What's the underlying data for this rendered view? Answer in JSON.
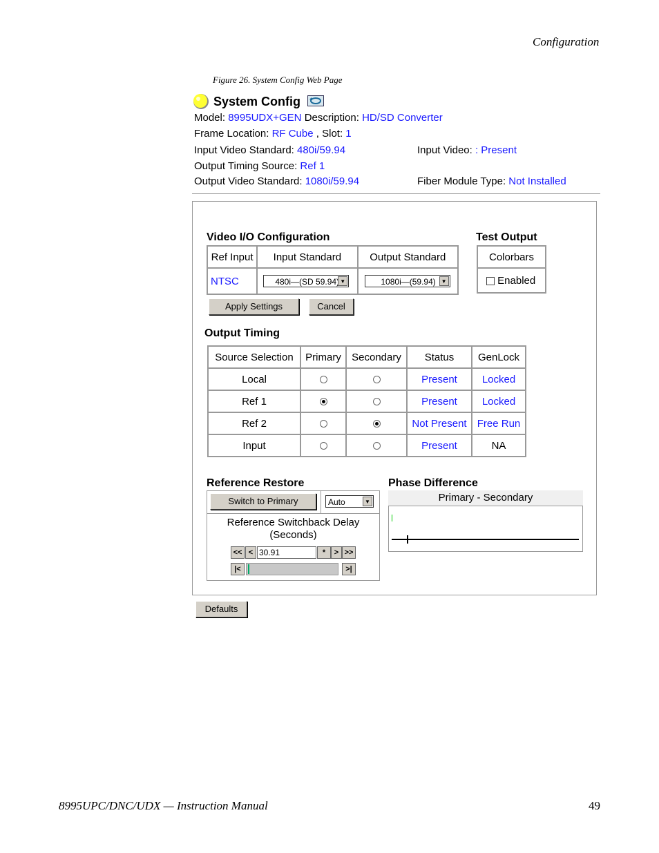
{
  "header": {
    "section": "Configuration"
  },
  "figure": {
    "caption": "Figure 26.  System Config Web Page"
  },
  "page": {
    "title": "System Config",
    "model_label": "Model:",
    "model_value": "8995UDX+GEN",
    "description_label": "Description:",
    "description_value": "HD/SD Converter",
    "frame_label": "Frame Location:",
    "frame_value": "RF Cube",
    "slot_label": ", Slot:",
    "slot_value": "1",
    "input_std_label": "Input Video Standard:",
    "input_std_value": "480i/59.94",
    "input_video_label": "Input Video:",
    "input_video_value": ": Present",
    "timing_label": "Output Timing Source:",
    "timing_value": "Ref 1",
    "output_std_label": "Output Video Standard:",
    "output_std_value": "1080i/59.94",
    "fiber_label": "Fiber Module Type:",
    "fiber_value": "Not Installed"
  },
  "video_io": {
    "title": "Video I/O Configuration",
    "headers": [
      "Ref Input",
      "Input Standard",
      "Output Standard"
    ],
    "ref_input": "NTSC",
    "input_standard": "480i—(SD 59.94)",
    "output_standard": "1080i—(59.94)"
  },
  "test_output": {
    "title": "Test Output",
    "header": "Colorbars",
    "enabled_label": "Enabled",
    "enabled": false
  },
  "buttons": {
    "apply": "Apply Settings",
    "cancel": "Cancel",
    "defaults": "Defaults",
    "switch_primary": "Switch to Primary"
  },
  "output_timing": {
    "title": "Output Timing",
    "headers": [
      "Source Selection",
      "Primary",
      "Secondary",
      "Status",
      "GenLock"
    ],
    "rows": [
      {
        "source": "Local",
        "primary": false,
        "secondary": false,
        "status": "Present",
        "genlock": "Locked",
        "genlock_blue": true
      },
      {
        "source": "Ref 1",
        "primary": true,
        "secondary": false,
        "status": "Present",
        "genlock": "Locked",
        "genlock_blue": true
      },
      {
        "source": "Ref 2",
        "primary": false,
        "secondary": true,
        "status": "Not Present",
        "genlock": "Free Run",
        "genlock_blue": true
      },
      {
        "source": "Input",
        "primary": false,
        "secondary": false,
        "status": "Present",
        "genlock": "NA",
        "genlock_blue": false
      }
    ]
  },
  "reference_restore": {
    "title": "Reference Restore",
    "mode": "Auto",
    "delay_label_1": "Reference Switchback Delay",
    "delay_label_2": "(Seconds)",
    "delay_value": "30.91",
    "slider_fraction": 0.0
  },
  "phase": {
    "title": "Phase Difference",
    "header": "Primary - Secondary"
  },
  "footer": {
    "manual": "8995UPC/DNC/UDX — Instruction Manual",
    "page_number": "49"
  }
}
